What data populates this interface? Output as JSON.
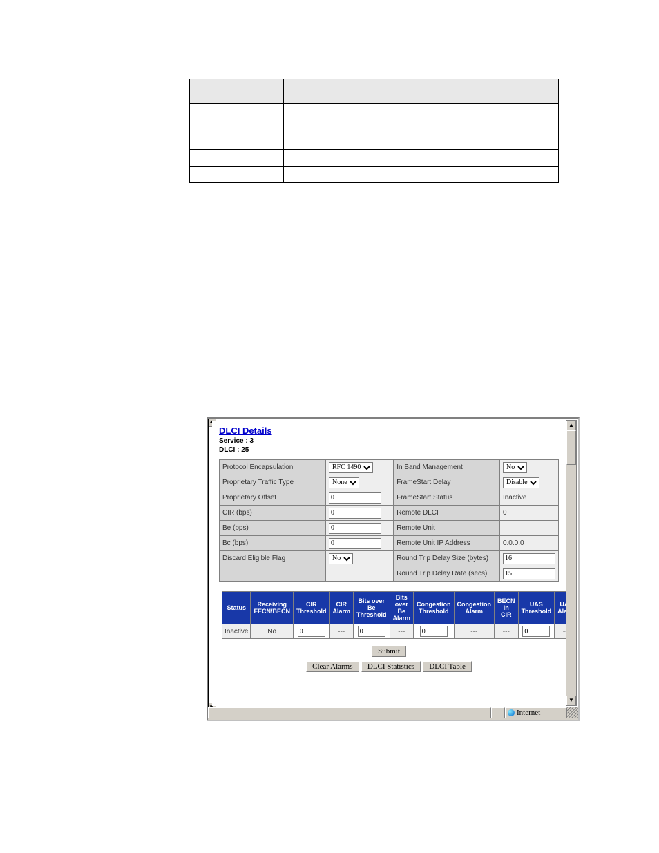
{
  "frame": {
    "title": "DLCI Details",
    "service_label": "Service :",
    "service_value": "3",
    "dlci_label": "DLCI :",
    "dlci_value": "25",
    "status_zone": "Internet"
  },
  "cfg_left": [
    {
      "label": "Protocol Encapsulation",
      "type": "select",
      "value": "RFC 1490"
    },
    {
      "label": "Proprietary Traffic Type",
      "type": "select",
      "value": "None"
    },
    {
      "label": "Proprietary  Offset",
      "type": "input",
      "value": "0"
    },
    {
      "label": "CIR (bps)",
      "type": "input",
      "value": "0"
    },
    {
      "label": "Be (bps)",
      "type": "input",
      "value": "0"
    },
    {
      "label": "Bc (bps)",
      "type": "input",
      "value": "0"
    },
    {
      "label": "Discard Eligible Flag",
      "type": "select",
      "value": "No"
    },
    {
      "label": "",
      "type": "blank",
      "value": ""
    }
  ],
  "cfg_right": [
    {
      "label": "In Band Management",
      "type": "select",
      "value": "No"
    },
    {
      "label": "FrameStart Delay",
      "type": "select",
      "value": "Disable"
    },
    {
      "label": "FrameStart Status",
      "type": "text",
      "value": "Inactive"
    },
    {
      "label": "Remote DLCI",
      "type": "text",
      "value": "0"
    },
    {
      "label": "Remote Unit",
      "type": "text",
      "value": ""
    },
    {
      "label": "Remote Unit IP Address",
      "type": "text",
      "value": "0.0.0.0"
    },
    {
      "label": "Round Trip Delay Size (bytes)",
      "type": "input",
      "value": "16"
    },
    {
      "label": "Round Trip Delay Rate (secs)",
      "type": "input",
      "value": "15"
    }
  ],
  "stats_headers": [
    "Status",
    "Receiving FECN/BECN",
    "CIR Threshold",
    "CIR Alarm",
    "Bits over Be Threshold",
    "Bits over Be Alarm",
    "Congestion Threshold",
    "Congestion Alarm",
    "BECN in CIR",
    "UAS Threshold",
    "UAS Alarm"
  ],
  "stats_row": {
    "status": "Inactive",
    "fecn_becn": "No",
    "cir_threshold": "0",
    "cir_alarm": "---",
    "bits_be_threshold": "0",
    "bits_be_alarm": "---",
    "congestion_threshold": "0",
    "congestion_alarm": "---",
    "becn_in_cir": "---",
    "uas_threshold": "0",
    "uas_alarm": "---"
  },
  "buttons": {
    "submit": "Submit",
    "clear": "Clear Alarms",
    "stats": "DLCI Statistics",
    "table": "DLCI Table"
  }
}
